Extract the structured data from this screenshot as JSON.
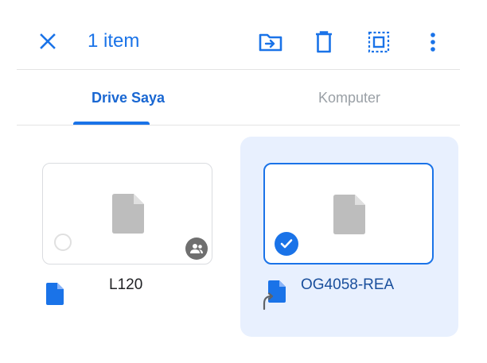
{
  "header": {
    "selection_count": "1 item"
  },
  "icons": {
    "close": "close-icon",
    "move": "move-to-folder-icon",
    "delete": "trash-icon",
    "select_all": "select-all-icon",
    "more": "more-vert-icon"
  },
  "tabs": [
    {
      "label": "Drive Saya",
      "active": true
    },
    {
      "label": "Komputer",
      "active": false
    }
  ],
  "files": [
    {
      "name": "L120",
      "selected": false,
      "shared": true,
      "type": "document"
    },
    {
      "name": "OG4058-REA",
      "selected": true,
      "shared": false,
      "type": "document-shortcut"
    }
  ],
  "colors": {
    "accent": "#1a73e8",
    "selected_card_bg": "#e8f0fe",
    "divider": "#e3e3e3",
    "inactive_tab": "#9aa0a6",
    "doc_gray": "#bdbdbd"
  }
}
